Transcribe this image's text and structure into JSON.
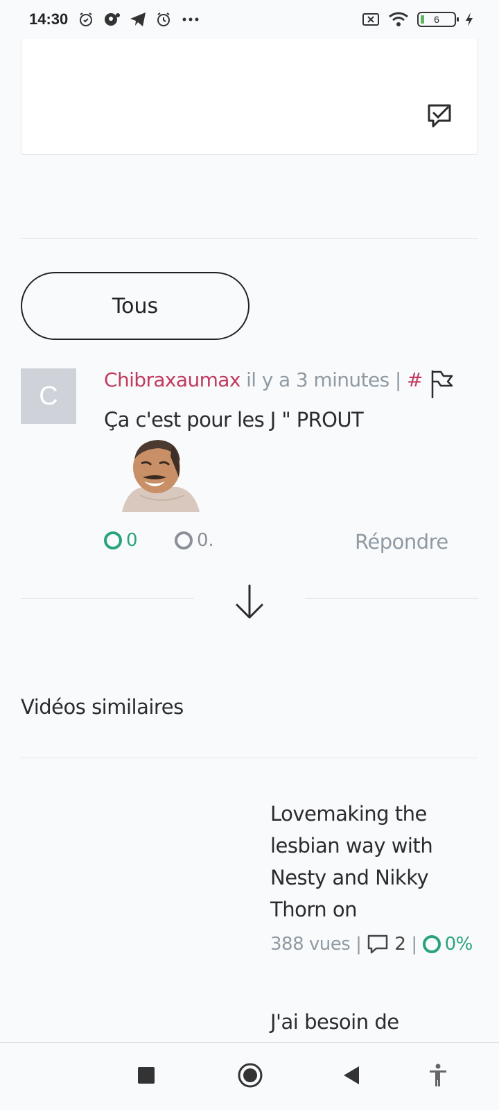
{
  "status_bar": {
    "time": "14:30",
    "battery_level": "6",
    "icons": [
      "alarm-icon",
      "notification-icon",
      "telegram-icon",
      "alarm-icon",
      "more-icon",
      "sim-off-icon",
      "wifi-icon",
      "battery-icon",
      "charging-icon"
    ]
  },
  "filter": {
    "label": "Tous"
  },
  "comment": {
    "avatar_letter": "C",
    "author": "Chibraxaumax",
    "time_ago": " il y a 3 minutes | ",
    "hash": "#",
    "text": "Ça c'est pour les J \" PROUT",
    "upvotes": "0",
    "downvotes": "0.",
    "reply_label": "Répondre"
  },
  "similar": {
    "section_title": "Vidéos similaires",
    "videos": [
      {
        "title": "Lovemaking the lesbian way with Nesty and Nikky Thorn on",
        "views": "388 vues |",
        "comments": "2",
        "sep": "|",
        "rating": "0%"
      },
      {
        "title": "J'ai besoin de"
      }
    ]
  },
  "colors": {
    "accent_pink": "#c23a5d",
    "accent_green": "#2aa37a",
    "muted": "#8f9aa3",
    "background": "#f9fafc"
  }
}
